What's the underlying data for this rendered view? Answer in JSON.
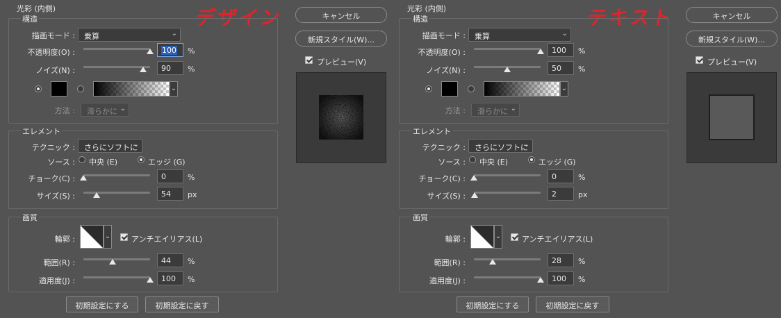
{
  "panels": [
    {
      "section_title": "光彩 (内側)",
      "structure_legend": "構造",
      "blend_mode_label": "描画モード :",
      "blend_mode_value": "乗算",
      "opacity_label": "不透明度(O) :",
      "opacity_value": "100",
      "opacity_level": 100,
      "noise_label": "ノイズ(N) :",
      "noise_value": "90",
      "noise_level": 90,
      "percent": "%",
      "px": "px",
      "method_label": "方法 :",
      "method_value": "滑らかに",
      "elements_legend": "エレメント",
      "technique_label": "テクニック :",
      "technique_value": "さらにソフトに",
      "source_label": "ソース :",
      "source_center": "中央 (E)",
      "source_edge": "エッジ (G)",
      "choke_label": "チョーク(C) :",
      "choke_value": "0",
      "choke_level": 0,
      "size_label": "サイズ(S) :",
      "size_value": "54",
      "size_level": 20,
      "quality_legend": "画質",
      "contour_label": "輪郭 :",
      "antialias_label": "アンチエイリアス(L)",
      "range_label": "範囲(R) :",
      "range_value": "44",
      "range_level": 44,
      "jitter_label": "適用度(J) :",
      "jitter_value": "100",
      "jitter_level": 100,
      "make_default": "初期設定にする",
      "reset_default": "初期設定に戻す",
      "cancel": "キャンセル",
      "new_style": "新規スタイル(W)...",
      "preview": "プレビュー(V)",
      "overlay_title": "デザイン"
    },
    {
      "section_title": "光彩 (内側)",
      "structure_legend": "構造",
      "blend_mode_label": "描画モード :",
      "blend_mode_value": "乗算",
      "opacity_label": "不透明度(O) :",
      "opacity_value": "100",
      "opacity_level": 100,
      "noise_label": "ノイズ(N) :",
      "noise_value": "50",
      "noise_level": 50,
      "percent": "%",
      "px": "px",
      "method_label": "方法 :",
      "method_value": "滑らかに",
      "elements_legend": "エレメント",
      "technique_label": "テクニック :",
      "technique_value": "さらにソフトに",
      "source_label": "ソース :",
      "source_center": "中央 (E)",
      "source_edge": "エッジ (G)",
      "choke_label": "チョーク(C) :",
      "choke_value": "0",
      "choke_level": 0,
      "size_label": "サイズ(S) :",
      "size_value": "2",
      "size_level": 1,
      "quality_legend": "画質",
      "contour_label": "輪郭 :",
      "antialias_label": "アンチエイリアス(L)",
      "range_label": "範囲(R) :",
      "range_value": "28",
      "range_level": 28,
      "jitter_label": "適用度(J) :",
      "jitter_value": "100",
      "jitter_level": 100,
      "make_default": "初期設定にする",
      "reset_default": "初期設定に戻す",
      "cancel": "キャンセル",
      "new_style": "新規スタイル(W)...",
      "preview": "プレビュー(V)",
      "overlay_title": "テキスト"
    }
  ]
}
